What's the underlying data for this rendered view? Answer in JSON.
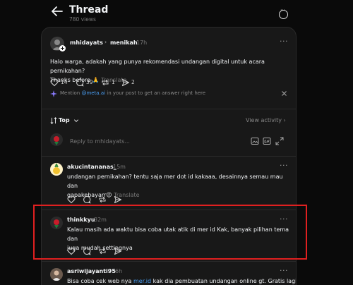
{
  "header": {
    "title": "Thread",
    "views": "780 views"
  },
  "post": {
    "author": "mhidayats",
    "arrow": "›",
    "tag": "menikah",
    "time": "17h",
    "text_line1": "Halo warga, adakah yang punya rekomendasi undangan digital untuk acara pernikahan?",
    "text_line2": "Thanks before 🙏",
    "translate": "Translate",
    "likes": "14",
    "comments": "39",
    "reposts": "1",
    "shares": "2",
    "mention_prefix": "Mention",
    "mention_handle": "@meta.ai",
    "mention_suffix": "in your post to get an answer right here"
  },
  "sort": {
    "label": "Top",
    "activity": "View activity ›"
  },
  "reply": {
    "placeholder": "Reply to mhidayats..."
  },
  "comments": [
    {
      "author": "akucintananas_",
      "time": "15m",
      "line1": "undangan pernikahan? tentu saja mer dot id kakaaa, desainnya semau mau dan",
      "line2": "gapakebayarr😉",
      "translate": "Translate"
    },
    {
      "author": "thinkkyu",
      "time": "32m",
      "line1": "Kalau masih ada waktu bisa coba utak atik di mer id Kak, banyak pilihan tema dan",
      "line2": "juga mudah settingnya"
    },
    {
      "author": "asriwijayanti95",
      "time": "6h",
      "line1_pre": "Bisa coba cek web nya",
      "line1_link": "mer.id",
      "line1_post": "kak dia pembuatan undangan online gt. Gratis lagi"
    }
  ],
  "colors": {
    "background": "#0a0a0a",
    "panel": "#181818",
    "link": "#4a9ff5",
    "highlight": "#e02020"
  }
}
